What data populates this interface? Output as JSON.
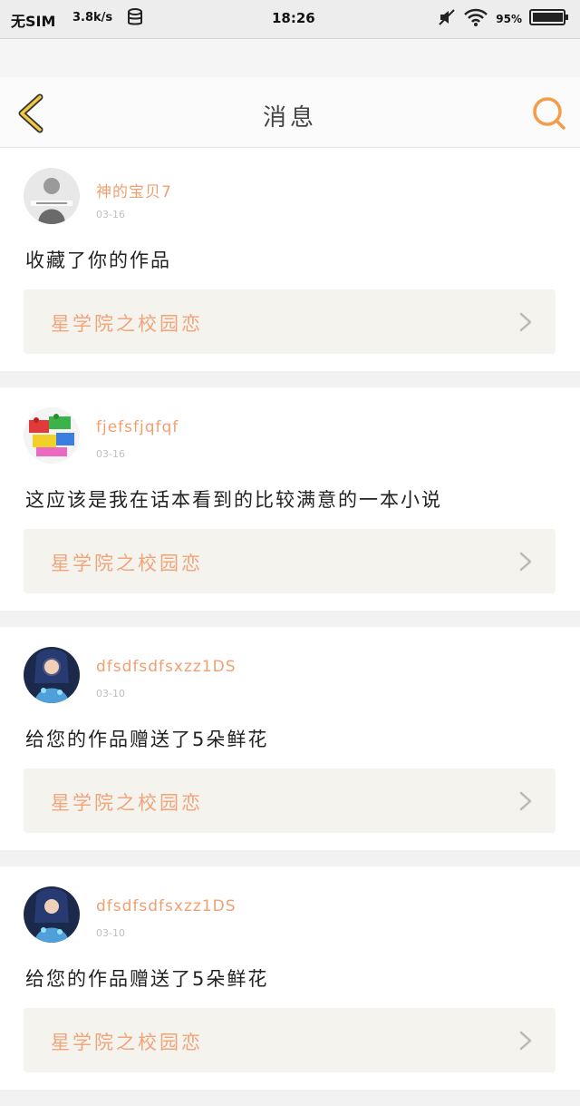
{
  "status_bar": {
    "carrier": "无SIM",
    "speed": "3.8k/s",
    "time": "18:26",
    "battery": "95%"
  },
  "header": {
    "title": "消息"
  },
  "colors": {
    "accent": "#f39c4a",
    "back_arrow": "#f2c744",
    "name": "#f0a070",
    "work_bg": "#f4f3ee"
  },
  "messages": [
    {
      "username": "神的宝贝7",
      "date": "03-16",
      "text": "收藏了你的作品",
      "work_title": "星学院之校园恋",
      "avatar": "person-sketch"
    },
    {
      "username": "fjefsfjqfqf",
      "date": "03-16",
      "text": "这应该是我在话本看到的比较满意的一本小说",
      "work_title": "星学院之校园恋",
      "avatar": "building-blocks"
    },
    {
      "username": "dfsdfsdfsxzz1DS",
      "date": "03-10",
      "text": "给您的作品赠送了5朵鲜花",
      "work_title": "星学院之校园恋",
      "avatar": "fantasy-character"
    },
    {
      "username": "dfsdfsdfsxzz1DS",
      "date": "03-10",
      "text": "给您的作品赠送了5朵鲜花",
      "work_title": "星学院之校园恋",
      "avatar": "fantasy-character"
    }
  ]
}
